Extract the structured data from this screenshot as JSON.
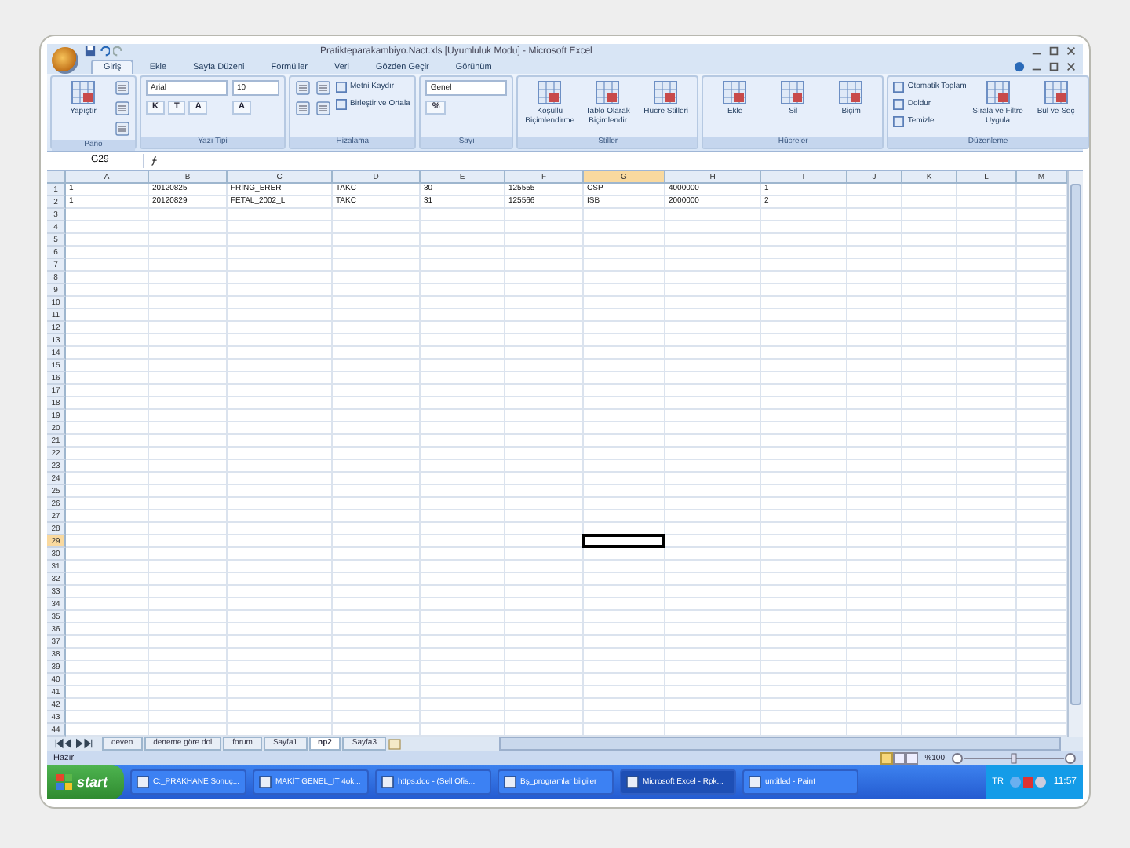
{
  "window": {
    "title": "Pratikteparakambiyo.Nact.xls [Uyumluluk Modu] - Microsoft Excel"
  },
  "tabs": [
    {
      "label": "Giriş",
      "selected": true
    },
    {
      "label": "Ekle",
      "selected": false
    },
    {
      "label": "Sayfa Düzeni",
      "selected": false
    },
    {
      "label": "Formüller",
      "selected": false
    },
    {
      "label": "Veri",
      "selected": false
    },
    {
      "label": "Gözden Geçir",
      "selected": false
    },
    {
      "label": "Görünüm",
      "selected": false
    }
  ],
  "ribbon": {
    "groups": [
      {
        "label": "Pano",
        "columns": [
          [
            {
              "kind": "large",
              "label": "Yapıştır"
            }
          ],
          [
            {
              "kind": "icon"
            },
            {
              "kind": "icon"
            },
            {
              "kind": "icon"
            }
          ]
        ]
      },
      {
        "label": "Yazı Tipi",
        "columns": [
          [
            {
              "kind": "field",
              "value": "Arial"
            },
            {
              "kind": "glyphs",
              "labels": [
                "K",
                "T",
                "A"
              ]
            }
          ],
          [
            {
              "kind": "field",
              "value": "10"
            },
            {
              "kind": "glyphs",
              "labels": [
                "A"
              ]
            }
          ]
        ]
      },
      {
        "label": "Hizalama",
        "columns": [
          [
            {
              "kind": "icon"
            },
            {
              "kind": "icon"
            }
          ],
          [
            {
              "kind": "icon"
            },
            {
              "kind": "icon"
            }
          ],
          [
            {
              "kind": "small",
              "label": "Metni Kaydır"
            },
            {
              "kind": "small",
              "label": "Birleştir ve Ortala"
            }
          ]
        ]
      },
      {
        "label": "Sayı",
        "columns": [
          [
            {
              "kind": "field",
              "value": "Genel"
            },
            {
              "kind": "glyphs",
              "labels": [
                "%"
              ]
            }
          ]
        ]
      },
      {
        "label": "Stiller",
        "columns": [
          [
            {
              "kind": "large",
              "label": "Koşullu Biçimlendirme"
            }
          ],
          [
            {
              "kind": "large",
              "label": "Tablo Olarak Biçimlendir"
            }
          ],
          [
            {
              "kind": "large",
              "label": "Hücre Stilleri"
            }
          ]
        ]
      },
      {
        "label": "Hücreler",
        "columns": [
          [
            {
              "kind": "large",
              "label": "Ekle"
            }
          ],
          [
            {
              "kind": "large",
              "label": "Sil"
            }
          ],
          [
            {
              "kind": "large",
              "label": "Biçim"
            }
          ]
        ]
      },
      {
        "label": "Düzenleme",
        "columns": [
          [
            {
              "kind": "small",
              "label": "Otomatik Toplam"
            },
            {
              "kind": "small",
              "label": "Doldur"
            },
            {
              "kind": "small",
              "label": "Temizle"
            }
          ],
          [
            {
              "kind": "large",
              "label": "Sırala ve Filtre Uygula"
            }
          ],
          [
            {
              "kind": "large",
              "label": "Bul ve Seç"
            }
          ]
        ]
      }
    ]
  },
  "formula_bar": {
    "name_box": "G29"
  },
  "table": {
    "columns": [
      {
        "label": "A",
        "selected": false
      },
      {
        "label": "B",
        "selected": false
      },
      {
        "label": "C",
        "selected": false
      },
      {
        "label": "D",
        "selected": false
      },
      {
        "label": "E",
        "selected": false
      },
      {
        "label": "F",
        "selected": false
      },
      {
        "label": "G",
        "selected": true
      },
      {
        "label": "H",
        "selected": false
      },
      {
        "label": "I",
        "selected": false
      },
      {
        "label": "J",
        "selected": false
      },
      {
        "label": "K",
        "selected": false
      },
      {
        "label": "L",
        "selected": false
      },
      {
        "label": "M",
        "selected": false
      }
    ],
    "rows": [
      {
        "number": "1",
        "selected": false,
        "cells": [
          "1",
          "20120825",
          "FRİNG_ERER",
          "TAKC",
          "30",
          "125555",
          "CSP",
          "4000000",
          "1"
        ]
      },
      {
        "number": "2",
        "selected": false,
        "cells": [
          "1",
          "20120829",
          "FETAL_2002_L",
          "TAKC",
          "31",
          "125566",
          "ISB",
          "2000000",
          "2"
        ]
      },
      {
        "number": "3",
        "selected": false
      },
      {
        "number": "4",
        "selected": false
      },
      {
        "number": "5",
        "selected": false
      },
      {
        "number": "6",
        "selected": false
      },
      {
        "number": "7",
        "selected": false
      },
      {
        "number": "8",
        "selected": false
      },
      {
        "number": "9",
        "selected": false
      },
      {
        "number": "10",
        "selected": false
      },
      {
        "number": "11",
        "selected": false
      },
      {
        "number": "12",
        "selected": false
      },
      {
        "number": "13",
        "selected": false
      },
      {
        "number": "14",
        "selected": false
      },
      {
        "number": "15",
        "selected": false
      },
      {
        "number": "16",
        "selected": false
      },
      {
        "number": "17",
        "selected": false
      },
      {
        "number": "18",
        "selected": false
      },
      {
        "number": "19",
        "selected": false
      },
      {
        "number": "20",
        "selected": false
      },
      {
        "number": "21",
        "selected": false
      },
      {
        "number": "22",
        "selected": false
      },
      {
        "number": "23",
        "selected": false
      },
      {
        "number": "24",
        "selected": false
      },
      {
        "number": "25",
        "selected": false
      },
      {
        "number": "26",
        "selected": false
      },
      {
        "number": "27",
        "selected": false
      },
      {
        "number": "28",
        "selected": false
      },
      {
        "number": "29",
        "selected": true
      },
      {
        "number": "30",
        "selected": false
      },
      {
        "number": "31",
        "selected": false
      },
      {
        "number": "32",
        "selected": false
      },
      {
        "number": "33",
        "selected": false
      },
      {
        "number": "34",
        "selected": false
      },
      {
        "number": "35",
        "selected": false
      },
      {
        "number": "36",
        "selected": false
      },
      {
        "number": "37",
        "selected": false
      },
      {
        "number": "38",
        "selected": false
      },
      {
        "number": "39",
        "selected": false
      },
      {
        "number": "40",
        "selected": false
      },
      {
        "number": "41",
        "selected": false
      },
      {
        "number": "42",
        "selected": false
      },
      {
        "number": "43",
        "selected": false
      },
      {
        "number": "44",
        "selected": false
      }
    ]
  },
  "sheet_tabs": [
    {
      "label": "deven",
      "selected": false
    },
    {
      "label": "deneme göre dol",
      "selected": false
    },
    {
      "label": "forum",
      "selected": false
    },
    {
      "label": "Sayfa1",
      "selected": false
    },
    {
      "label": "np2",
      "selected": true
    },
    {
      "label": "Sayfa3",
      "selected": false
    }
  ],
  "status_bar": {
    "text": "Hazır",
    "zoom": "%100",
    "zoom_slider": {
      "level": 0.5
    }
  },
  "taskbar": {
    "start": "start",
    "tasks": [
      {
        "label": "C:_PRAKHANE Sonuç...",
        "selected": false
      },
      {
        "label": "MAKİT GENEL_IT 4ok...",
        "selected": false
      },
      {
        "label": "https.doc - (Sell Ofis...",
        "selected": false
      },
      {
        "label": "Bş_programlar bilgiler",
        "selected": false
      },
      {
        "label": "Microsoft Excel - Rpk...",
        "selected": true
      },
      {
        "label": "untitled - Paint",
        "selected": false
      }
    ],
    "language": "TR",
    "time": "11:57"
  }
}
